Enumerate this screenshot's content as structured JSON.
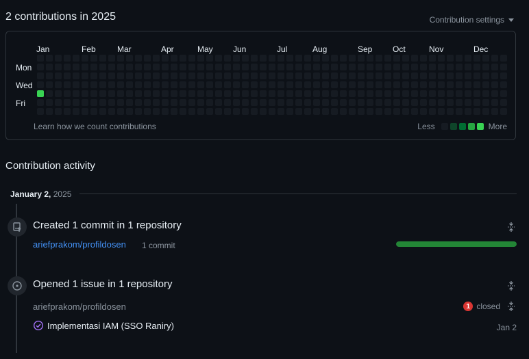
{
  "header": {
    "title": "2 contributions in 2025",
    "settings_label": "Contribution settings"
  },
  "graph": {
    "months": [
      "Jan",
      "Feb",
      "Mar",
      "Apr",
      "May",
      "Jun",
      "Jul",
      "Aug",
      "Sep",
      "Oct",
      "Nov",
      "Dec"
    ],
    "day_labels": [
      "Mon",
      "Wed",
      "Fri"
    ],
    "weeks": 53,
    "active_cells": [
      {
        "week": 0,
        "day": 4,
        "level": 4
      }
    ],
    "learn_link": "Learn how we count contributions",
    "legend_less": "Less",
    "legend_more": "More",
    "legend_colors": [
      "#161b22",
      "#0e4429",
      "#006d32",
      "#26a641",
      "#39d353"
    ]
  },
  "activity": {
    "title": "Contribution activity",
    "date_label": "January 2,",
    "year_label": "2025",
    "events": [
      {
        "title": "Created 1 commit in 1 repository",
        "repo": "ariefprakom/profildosen",
        "count": "1 commit",
        "progress": 1.0
      },
      {
        "title": "Opened 1 issue in 1 repository",
        "repo": "ariefprakom/profildosen",
        "closed_count": "1",
        "closed_label": "closed",
        "issue_title": "Implementasi IAM (SSO Raniry)",
        "issue_date": "Jan 2"
      }
    ]
  },
  "colors": {
    "background": "#0d1117",
    "border": "#30363d",
    "link": "#4493f8",
    "progress": "#238636",
    "closed_badge": "#da3633",
    "issue_icon": "#a371f7"
  }
}
